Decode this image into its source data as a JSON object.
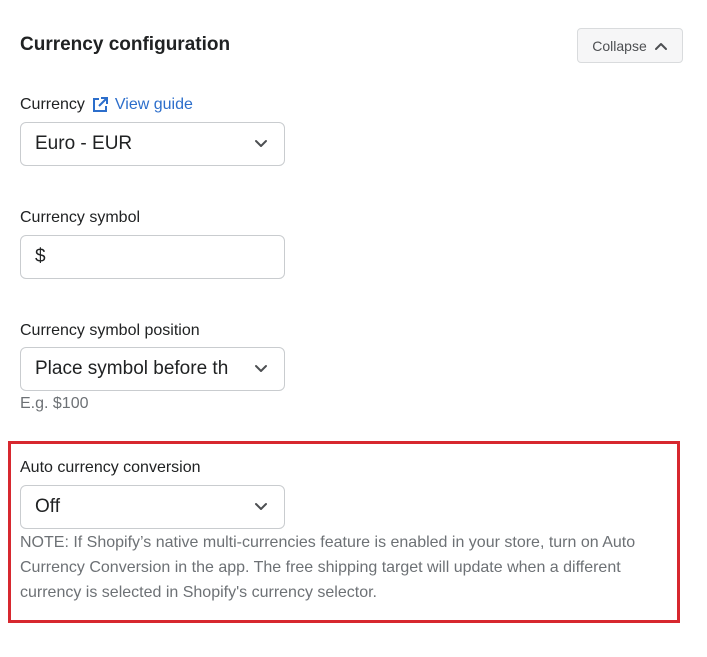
{
  "section": {
    "title": "Currency configuration",
    "collapse_label": "Collapse"
  },
  "currency": {
    "label": "Currency",
    "guide_link": "View guide",
    "value": "Euro - EUR"
  },
  "currency_symbol": {
    "label": "Currency symbol",
    "value": "$"
  },
  "symbol_position": {
    "label": "Currency symbol position",
    "value": "Place symbol before th",
    "help": "E.g. $100"
  },
  "auto_conversion": {
    "label": "Auto currency conversion",
    "value": "Off",
    "note": "NOTE: If Shopify’s native multi-currencies feature is enabled in your store, turn on Auto Currency Conversion in the app. The free shipping target will update when a different currency is selected in Shopify's currency selector."
  },
  "colors": {
    "link": "#2c6ecb",
    "highlight_border": "#d7282f",
    "help_text": "#6d7175"
  },
  "icons": {
    "collapse": "chevron-up-icon",
    "guide": "external-link-icon",
    "select": "chevron-down-icon"
  }
}
